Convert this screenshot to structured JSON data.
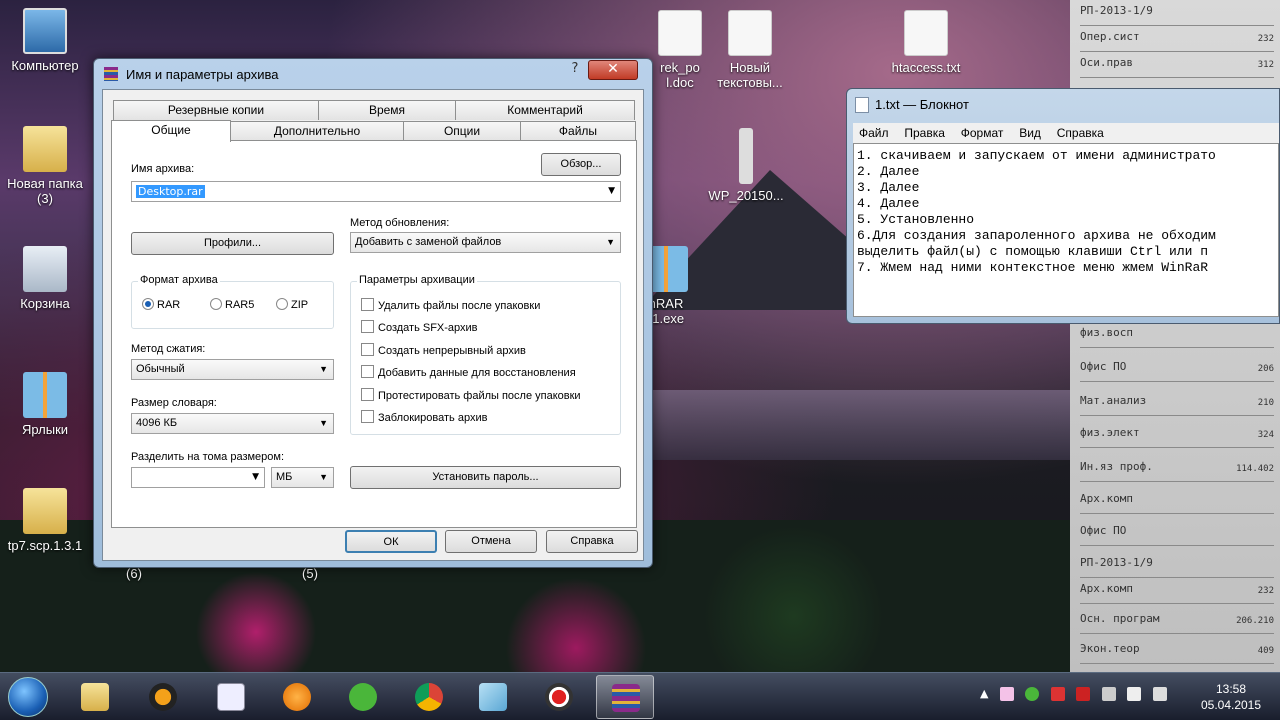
{
  "desktop": {
    "icons": [
      {
        "label": "Компьютер",
        "sub": ""
      },
      {
        "label": "Новая папка",
        "sub": "(3)"
      },
      {
        "label": "Корзина",
        "sub": ""
      },
      {
        "label": "Ярлыки",
        "sub": ""
      },
      {
        "label": "tp7.scp.1.3.1",
        "sub": "(6)"
      },
      {
        "label": "rek_po",
        "sub": "l.doc"
      },
      {
        "label": "Новый",
        "sub": "текстовы..."
      },
      {
        "label": "htaccess.txt",
        "sub": ""
      },
      {
        "label": "WP_20150...",
        "sub": ""
      },
      {
        "label": "nRAR",
        "sub": "r1.exe"
      },
      {
        "label": "(5)",
        "sub": ""
      }
    ]
  },
  "paper": {
    "lines": [
      {
        "name": "РП-2013-1/9",
        "num": ""
      },
      {
        "name": "Опер.сист",
        "num": "232"
      },
      {
        "name": "Оси.прав",
        "num": "312"
      },
      {
        "name": "физ.восп",
        "num": ""
      },
      {
        "name": "Офис ПО",
        "num": "206"
      },
      {
        "name": "Мат.анализ",
        "num": "210"
      },
      {
        "name": "физ.элект",
        "num": "324"
      },
      {
        "name": "Ин.яз проф.",
        "num": "114.402"
      },
      {
        "name": "Арх.комп",
        "num": ""
      },
      {
        "name": "Офис ПО",
        "num": ""
      },
      {
        "name": "РП-2013-1/9",
        "num": ""
      },
      {
        "name": "Арх.комп",
        "num": "232"
      },
      {
        "name": "Осн. програм",
        "num": "206.210"
      },
      {
        "name": "Экон.теор",
        "num": "409"
      }
    ]
  },
  "dialog": {
    "title": "Имя и параметры архива",
    "help": "?",
    "close": "✕",
    "tabs_row1": [
      "Резервные копии",
      "Время",
      "Комментарий"
    ],
    "tabs_row2": [
      "Общие",
      "Дополнительно",
      "Опции",
      "Файлы"
    ],
    "archive_name_label": "Имя архива:",
    "browse_button": "Обзор...",
    "archive_name_value": "Desktop.rar",
    "profiles_button": "Профили...",
    "update_method_label": "Метод обновления:",
    "update_method_value": "Добавить с заменой файлов",
    "format_label": "Формат архива",
    "format_options": [
      "RAR",
      "RAR5",
      "ZIP"
    ],
    "archive_params_label": "Параметры архивации",
    "archive_params": [
      "Удалить файлы после упаковки",
      "Создать SFX-архив",
      "Создать непрерывный архив",
      "Добавить данные для восстановления",
      "Протестировать файлы после упаковки",
      "Заблокировать архив"
    ],
    "compression_label": "Метод сжатия:",
    "compression_value": "Обычный",
    "dictionary_label": "Размер словаря:",
    "dictionary_value": "4096 КБ",
    "split_label": "Разделить на тома размером:",
    "split_unit": "МБ",
    "password_button": "Установить пароль...",
    "ok": "ОК",
    "cancel": "Отмена",
    "help_button": "Справка"
  },
  "notepad": {
    "title": "1.txt — Блокнот",
    "menu": [
      "Файл",
      "Правка",
      "Формат",
      "Вид",
      "Справка"
    ],
    "lines": [
      "1. скачиваем и запускаем от имени администрато",
      "2. Далее",
      "3. Далее",
      "4. Далее",
      "5. Установленно",
      "6.Для создания запароленного архива не обходим",
      "выделить файл(ы) с помощью клавиши Ctrl или п",
      "7. Жмем над ними контекстное меню жмем WinRaR"
    ]
  },
  "taskbar": {
    "time": "13:58",
    "date": "05.04.2015"
  },
  "colors": {
    "accent": "#3399ff",
    "close": "#c13b26"
  }
}
